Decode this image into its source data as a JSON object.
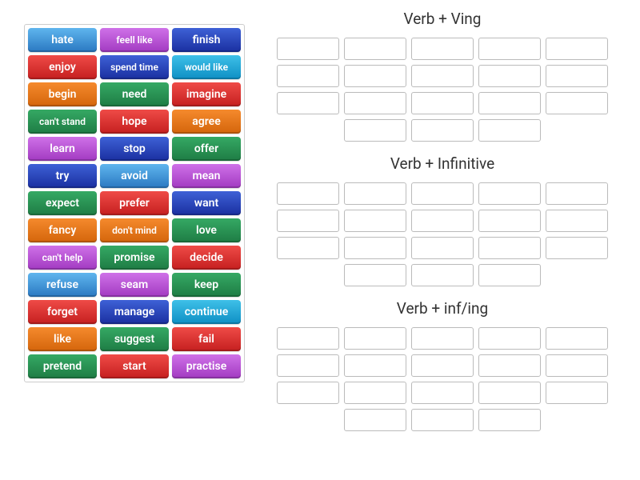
{
  "colors": {
    "blue": "linear-gradient(#5fb5ee,#2a78c1)",
    "purple": "linear-gradient(#cf71e8,#a23ac1)",
    "navy": "linear-gradient(#3e61d6,#1a2fa0)",
    "red": "linear-gradient(#ef4b47,#c51f1f)",
    "orange": "linear-gradient(#f58a2d,#d4650b)",
    "green": "linear-gradient(#35a964,#1e7c44)",
    "cyan": "linear-gradient(#3ec0e8,#0e8fc4)"
  },
  "tiles": [
    {
      "label": "hate",
      "colorKey": "blue"
    },
    {
      "label": "feell like",
      "colorKey": "purple"
    },
    {
      "label": "finish",
      "colorKey": "navy"
    },
    {
      "label": "enjoy",
      "colorKey": "red"
    },
    {
      "label": "spend time",
      "colorKey": "navy"
    },
    {
      "label": "would like",
      "colorKey": "cyan"
    },
    {
      "label": "begin",
      "colorKey": "orange"
    },
    {
      "label": "need",
      "colorKey": "green"
    },
    {
      "label": "imagine",
      "colorKey": "red"
    },
    {
      "label": "can't stand",
      "colorKey": "green"
    },
    {
      "label": "hope",
      "colorKey": "red"
    },
    {
      "label": "agree",
      "colorKey": "orange"
    },
    {
      "label": "learn",
      "colorKey": "purple"
    },
    {
      "label": "stop",
      "colorKey": "navy"
    },
    {
      "label": "offer",
      "colorKey": "green"
    },
    {
      "label": "try",
      "colorKey": "navy"
    },
    {
      "label": "avoid",
      "colorKey": "blue"
    },
    {
      "label": "mean",
      "colorKey": "purple"
    },
    {
      "label": "expect",
      "colorKey": "green"
    },
    {
      "label": "prefer",
      "colorKey": "red"
    },
    {
      "label": "want",
      "colorKey": "navy"
    },
    {
      "label": "fancy",
      "colorKey": "orange"
    },
    {
      "label": "don't mind",
      "colorKey": "orange"
    },
    {
      "label": "love",
      "colorKey": "green"
    },
    {
      "label": "can't help",
      "colorKey": "purple"
    },
    {
      "label": "promise",
      "colorKey": "green"
    },
    {
      "label": "decide",
      "colorKey": "red"
    },
    {
      "label": "refuse",
      "colorKey": "blue"
    },
    {
      "label": "seam",
      "colorKey": "purple"
    },
    {
      "label": "keep",
      "colorKey": "green"
    },
    {
      "label": "forget",
      "colorKey": "red"
    },
    {
      "label": "manage",
      "colorKey": "navy"
    },
    {
      "label": "continue",
      "colorKey": "cyan"
    },
    {
      "label": "like",
      "colorKey": "orange"
    },
    {
      "label": "suggest",
      "colorKey": "green"
    },
    {
      "label": "fail",
      "colorKey": "red"
    },
    {
      "label": "pretend",
      "colorKey": "green"
    },
    {
      "label": "start",
      "colorKey": "red"
    },
    {
      "label": "practise",
      "colorKey": "purple"
    }
  ],
  "groups": [
    {
      "title": "Verb + Ving",
      "slots": 18
    },
    {
      "title": "Verb + Infinitive",
      "slots": 18
    },
    {
      "title": "Verb + inf/ing",
      "slots": 18
    }
  ]
}
